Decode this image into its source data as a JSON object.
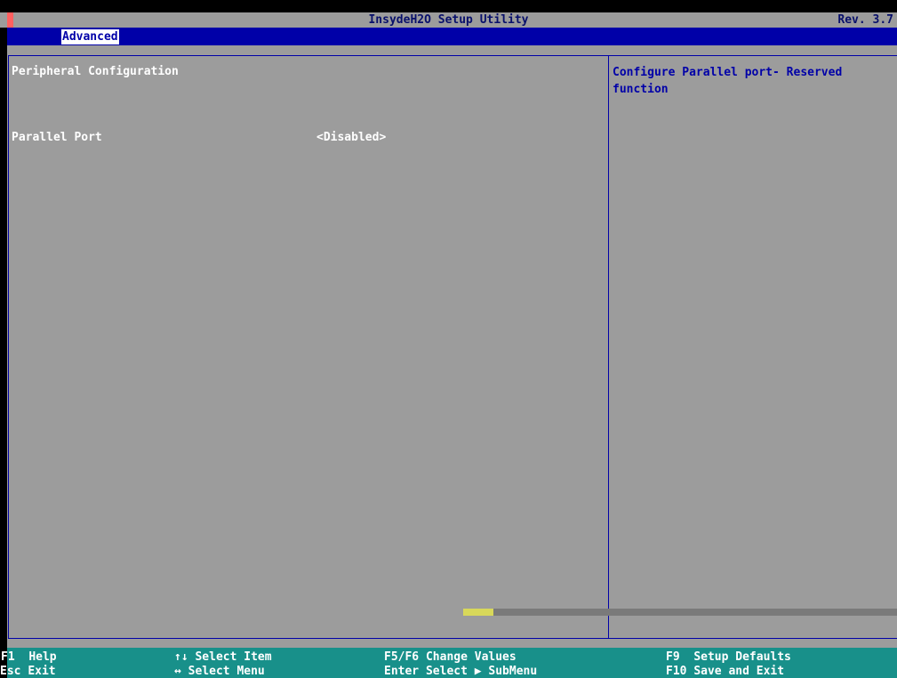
{
  "title_bar": {
    "title": "InsydeH2O Setup Utility",
    "revision": "Rev. 3.7"
  },
  "menu": {
    "tabs": [
      {
        "label": "Advanced",
        "selected": true
      }
    ]
  },
  "main": {
    "section_title": "Peripheral Configuration",
    "items": [
      {
        "label": "Parallel Port",
        "value": "<Disabled>"
      }
    ]
  },
  "help": {
    "text": "Configure Parallel port- Reserved function"
  },
  "footer": {
    "keys": [
      {
        "key": "F1",
        "action": "Help"
      },
      {
        "key": "Esc",
        "action": "Exit"
      },
      {
        "key": "↑↓",
        "action": "Select Item"
      },
      {
        "key": "↔",
        "action": "Select Menu"
      },
      {
        "key": "F5/F6",
        "action": "Change Values"
      },
      {
        "key": "Enter",
        "action": "Select ▶ SubMenu"
      },
      {
        "key": "F9",
        "action": "Setup Defaults"
      },
      {
        "key": "F10",
        "action": "Save and Exit"
      }
    ]
  },
  "colors": {
    "background_gray": "#9c9c9c",
    "menu_blue": "#0000a8",
    "footer_teal": "#18908a",
    "help_text_blue": "#0000a8"
  }
}
